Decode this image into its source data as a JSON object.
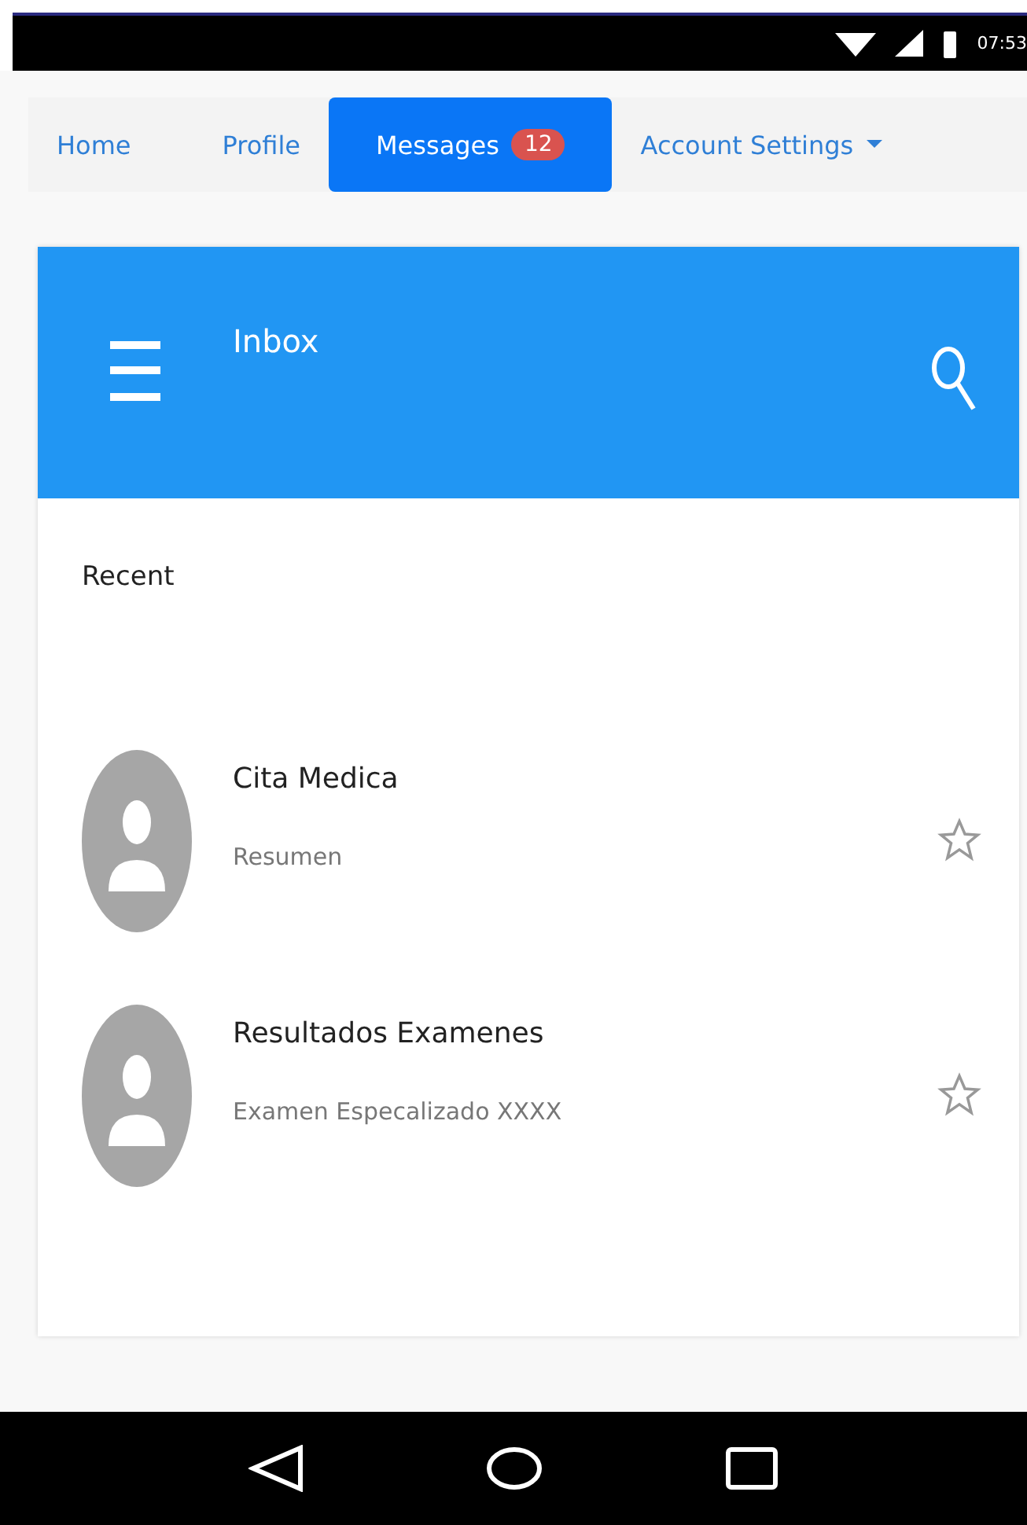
{
  "status_bar": {
    "time": "07:53"
  },
  "tabs": [
    {
      "label": "Home",
      "selected": false
    },
    {
      "label": "Profile",
      "selected": false
    },
    {
      "label": "Messages",
      "selected": true,
      "badge": "12"
    },
    {
      "label": "Account Settings",
      "selected": false,
      "dropdown": true
    }
  ],
  "app_bar": {
    "title": "Inbox"
  },
  "section": "Recent",
  "messages": [
    {
      "title": "Cita Medica",
      "subtitle": "Resumen",
      "starred": false
    },
    {
      "title": "Resultados Examenes",
      "subtitle": "Examen Especalizado XXXX",
      "starred": false
    }
  ]
}
